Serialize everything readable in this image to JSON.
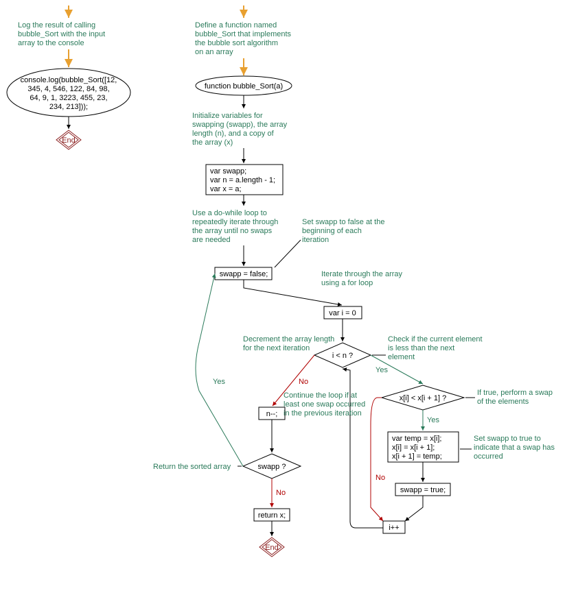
{
  "left": {
    "annot1_l1": "Log the result of calling",
    "annot1_l2": "bubble_Sort with the input",
    "annot1_l3": "array to the console",
    "call_l1": "console.log(bubble_Sort([12,",
    "call_l2": "345, 4, 546, 122, 84, 98,",
    "call_l3": "64, 9, 1, 3223, 455, 23,",
    "call_l4": "234, 213]));",
    "end": "End"
  },
  "right": {
    "annot_def_l1": "Define a function named",
    "annot_def_l2": "bubble_Sort that implements",
    "annot_def_l3": "the bubble sort algorithm",
    "annot_def_l4": "on an array",
    "func": "function bubble_Sort(a)",
    "annot_init_l1": "Initialize variables for",
    "annot_init_l2": "swapping (swapp), the array",
    "annot_init_l3": "length (n), and a copy of",
    "annot_init_l4": "the array (x)",
    "init_l1": "var swapp;",
    "init_l2": "var n = a.length - 1;",
    "init_l3": "var x = a;",
    "annot_do_l1": "Use a do-while loop to",
    "annot_do_l2": "repeatedly iterate through",
    "annot_do_l3": "the array until no swaps",
    "annot_do_l4": "are needed",
    "annot_setfalse_l1": "Set swapp to false at the",
    "annot_setfalse_l2": "beginning of each",
    "annot_setfalse_l3": "iteration",
    "swapp_false": "swapp = false;",
    "annot_for_l1": "Iterate through the array",
    "annot_for_l2": "using a for loop",
    "var_i": "var i = 0",
    "cond_i": "i < n ?",
    "annot_check_l1": "Check if the current element",
    "annot_check_l2": "is less than the next",
    "annot_check_l3": "element",
    "cond_x": "x[i] < x[i + 1] ?",
    "annot_swap_l1": "If true, perform a swap",
    "annot_swap_l2": "of the elements",
    "swap_l1": "var temp = x[i];",
    "swap_l2": "x[i] = x[i + 1];",
    "swap_l3": "x[i + 1] = temp;",
    "annot_settrue_l1": "Set swapp to true to",
    "annot_settrue_l2": "indicate that a swap has",
    "annot_settrue_l3": "occurred",
    "swapp_true": "swapp = true;",
    "ipp": "i++",
    "annot_dec_l1": "Decrement the array length",
    "annot_dec_l2": "for the next iteration",
    "ndec": "n--;",
    "annot_cont_l1": "Continue the loop if at",
    "annot_cont_l2": "least one swap occurred",
    "annot_cont_l3": "in the previous iteration",
    "cond_swapp": "swapp ?",
    "annot_ret": "Return the sorted array",
    "ret": "return x;",
    "end": "End",
    "yes": "Yes",
    "no": "No"
  }
}
